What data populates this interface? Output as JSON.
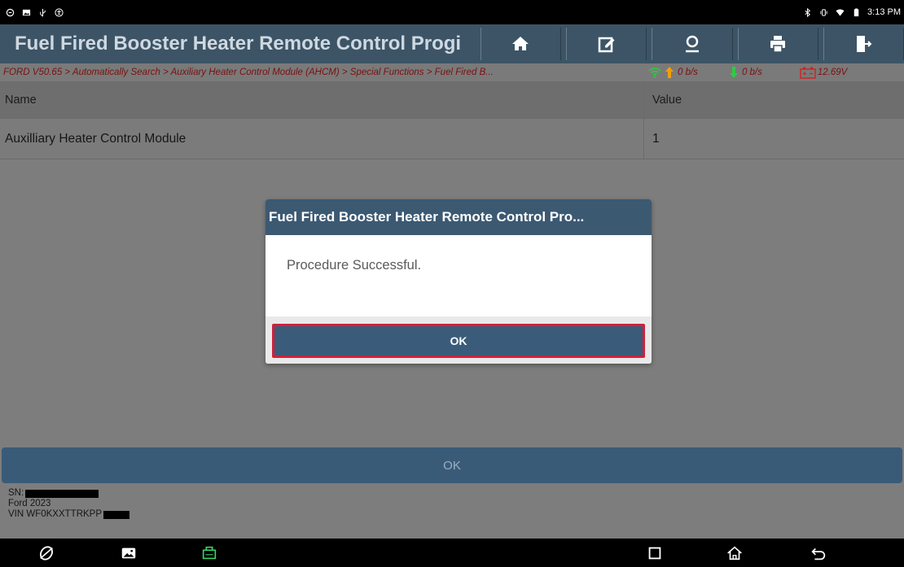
{
  "status_bar": {
    "time": "3:13 PM",
    "left_icons": [
      "chat-icon",
      "image-icon",
      "usb-icon",
      "accessibility-icon"
    ],
    "right_icons": [
      "bluetooth-icon",
      "vibrate-icon",
      "wifi-icon",
      "battery-icon"
    ]
  },
  "title_bar": {
    "title": "Fuel Fired Booster Heater Remote Control Progi",
    "buttons": [
      {
        "name": "home-button",
        "icon": "home-icon"
      },
      {
        "name": "edit-button",
        "icon": "edit-icon"
      },
      {
        "name": "user-button",
        "icon": "user-icon"
      },
      {
        "name": "print-button",
        "icon": "print-icon"
      },
      {
        "name": "exit-button",
        "icon": "exit-icon"
      }
    ]
  },
  "breadcrumb": {
    "path": "FORD V50.65 > Automatically Search > Auxiliary Heater Control Module (AHCM) > Special Functions > Fuel Fired B...",
    "upload_rate": "0 b/s",
    "download_rate": "0 b/s",
    "battery_voltage": "12.69V"
  },
  "table": {
    "headers": {
      "name": "Name",
      "value": "Value"
    },
    "rows": [
      {
        "name": "Auxilliary Heater Control Module",
        "value": "1"
      }
    ]
  },
  "bottom_button": {
    "label": "OK"
  },
  "device_info": {
    "sn_label": "SN:",
    "vehicle": "Ford  2023",
    "vin_label": "VIN WF0KXXTTRKPP"
  },
  "dialog": {
    "title": "Fuel Fired Booster Heater Remote Control Pro...",
    "message": "Procedure Successful.",
    "ok_label": "OK"
  },
  "colors": {
    "title_bar": "#3c5466",
    "breadcrumb_text": "#7a1010",
    "dialog_title": "#3c5972",
    "ok_button": "#3a5c7a",
    "ok_highlight": "#d51e3a",
    "vci_icon": "#3bd26a"
  }
}
